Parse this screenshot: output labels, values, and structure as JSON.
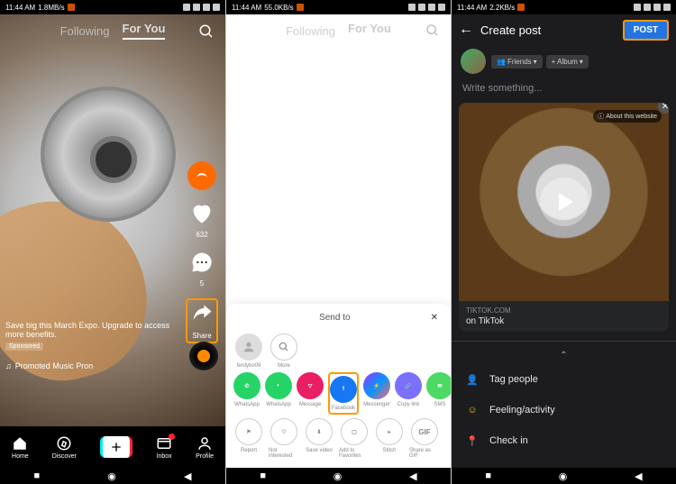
{
  "screen1": {
    "statusbar": {
      "time": "11:44 AM",
      "net": "1.8MB/s"
    },
    "tabs": {
      "following": "Following",
      "foryou": "For You"
    },
    "promo_text": "Save big this March Expo. Upgrade to access more benefits.",
    "sponsored": "Sponsored",
    "music": "Promoted Music   Pron",
    "rail": {
      "likes": "632",
      "comments": "5",
      "share": "Share"
    },
    "nav": {
      "home": "Home",
      "discover": "Discover",
      "inbox": "Inbox",
      "profile": "Profile"
    }
  },
  "screen2": {
    "statusbar": {
      "time": "11:44 AM",
      "net": "55.0KB/s"
    },
    "tabs": {
      "following": "Following",
      "foryou": "For You"
    },
    "sendto": "Send to",
    "contact": "ferdybo09",
    "more": "More",
    "share": {
      "whatsapp1": "WhatsApp",
      "whatsapp2": "WhatsApp",
      "message": "Message",
      "facebook": "Facebook",
      "messenger": "Messenger",
      "copylink": "Copy link",
      "sms": "SMS",
      "report": "Report",
      "notinterested": "Not interested",
      "save": "Save video",
      "addfav": "Add to Favorites",
      "stitch": "Stitch",
      "gif": "GIF",
      "shareas": "Share as GIF"
    }
  },
  "screen3": {
    "statusbar": {
      "time": "11:44 AM",
      "net": "2.2KB/s"
    },
    "header": {
      "title": "Create post",
      "post": "POST"
    },
    "chips": {
      "friends": "Friends",
      "album": "+ Album"
    },
    "placeholder": "Write something...",
    "about": "About this website",
    "meta_domain": "TIKTOK.COM",
    "meta_title": "on TikTok",
    "opts": {
      "tag": "Tag people",
      "feeling": "Feeling/activity",
      "checkin": "Check in"
    }
  }
}
